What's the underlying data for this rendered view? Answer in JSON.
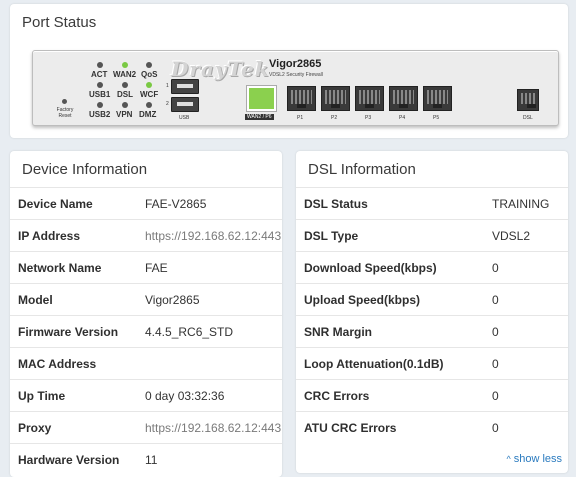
{
  "port_status": {
    "title": "Port Status",
    "router": {
      "brand": "DrayTek",
      "model": "Vigor2865",
      "subtitle": "VDSL2 Security Firewall",
      "leds": [
        {
          "label": "ACT",
          "state": "off"
        },
        {
          "label": "WAN2",
          "state": "on"
        },
        {
          "label": "QoS",
          "state": "off"
        },
        {
          "label": "USB1",
          "state": "off"
        },
        {
          "label": "DSL",
          "state": "off"
        },
        {
          "label": "WCF",
          "state": "on"
        },
        {
          "label": "USB2",
          "state": "off"
        },
        {
          "label": "VPN",
          "state": "off"
        },
        {
          "label": "DMZ",
          "state": "off"
        }
      ],
      "factory_reset_label": "Factory Reset",
      "usb_label": "USB",
      "usb_port_numbers": [
        "1",
        "2"
      ],
      "lan_ports": [
        {
          "label": "WAN2 / P6",
          "active": true
        },
        {
          "label": "P1",
          "active": false
        },
        {
          "label": "P2",
          "active": false
        },
        {
          "label": "P3",
          "active": false
        },
        {
          "label": "P4",
          "active": false
        },
        {
          "label": "P5",
          "active": false
        }
      ],
      "dsl_port_label": "DSL",
      "active_color": "#8bd04e",
      "led_on_color": "#7ac943"
    }
  },
  "device_info": {
    "title": "Device Information",
    "rows": [
      {
        "key": "Device Name",
        "value": "FAE-V2865"
      },
      {
        "key": "IP Address",
        "value": "https://192.168.62.12:443"
      },
      {
        "key": "Network Name",
        "value": "FAE"
      },
      {
        "key": "Model",
        "value": "Vigor2865"
      },
      {
        "key": "Firmware Version",
        "value": "4.4.5_RC6_STD"
      },
      {
        "key": "MAC Address",
        "value": ""
      },
      {
        "key": "Up Time",
        "value": "0 day 03:32:36"
      },
      {
        "key": "Proxy",
        "value": "https://192.168.62.12:443"
      },
      {
        "key": "Hardware Version",
        "value": "11"
      }
    ]
  },
  "dsl_info": {
    "title": "DSL Information",
    "rows": [
      {
        "key": "DSL Status",
        "value": "TRAINING"
      },
      {
        "key": "DSL Type",
        "value": "VDSL2"
      },
      {
        "key": "Download Speed(kbps)",
        "value": "0"
      },
      {
        "key": "Upload Speed(kbps)",
        "value": "0"
      },
      {
        "key": "SNR Margin",
        "value": "0"
      },
      {
        "key": "Loop Attenuation(0.1dB)",
        "value": "0"
      },
      {
        "key": "CRC Errors",
        "value": "0"
      },
      {
        "key": "ATU CRC Errors",
        "value": "0"
      }
    ],
    "show_less_label": "show less",
    "link_color": "#2b7bbf"
  }
}
